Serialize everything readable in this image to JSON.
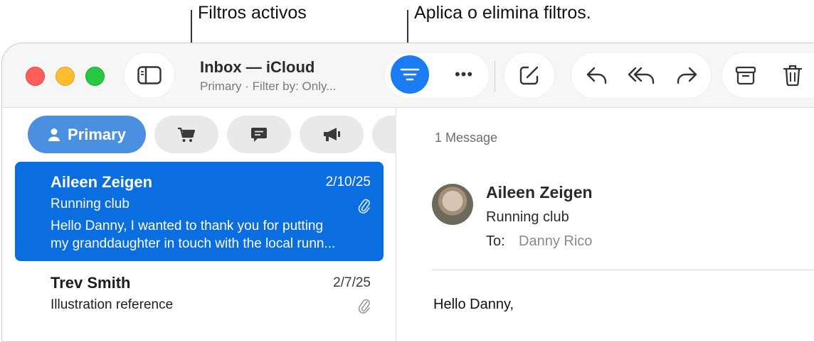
{
  "callouts": {
    "active_filters": "Filtros activos",
    "apply_remove": "Aplica o elimina filtros."
  },
  "window": {
    "title": "Inbox — iCloud",
    "subtitle": "Primary · Filter by: Only..."
  },
  "toolbar": {
    "more_label": "•••"
  },
  "categories": {
    "primary_label": "Primary"
  },
  "messages": [
    {
      "from": "Aileen Zeigen",
      "date": "2/10/25",
      "subject": "Running club",
      "preview_line1": "Hello Danny, I wanted to thank you for putting",
      "preview_line2": "my granddaughter in touch with the local runn...",
      "has_attachment": true,
      "selected": true
    },
    {
      "from": "Trev Smith",
      "date": "2/7/25",
      "subject": "Illustration reference",
      "has_attachment": true,
      "selected": false
    }
  ],
  "reading": {
    "count": "1 Message",
    "sender": "Aileen Zeigen",
    "subject": "Running club",
    "to_label": "To:",
    "to_value": "Danny Rico",
    "greeting": "Hello Danny,"
  },
  "colors": {
    "accent": "#1a7cf2",
    "selected_row": "#0a6de0",
    "primary_tab": "#4a8fe0"
  }
}
